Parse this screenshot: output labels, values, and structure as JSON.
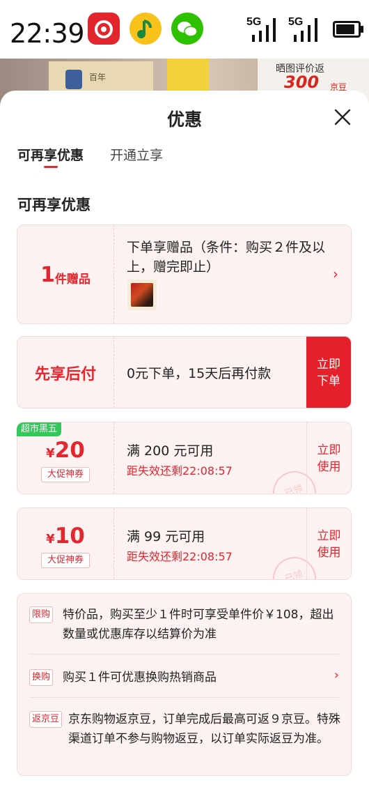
{
  "status_bar": {
    "time": "22:39",
    "network_1": "5G",
    "network_2": "5G"
  },
  "background": {
    "sign_top": "晒图评价返",
    "sign_amount": "300",
    "sign_unit": "京豆",
    "box_text": "百年"
  },
  "sheet": {
    "title": "优惠",
    "tabs": [
      {
        "label": "可再享优惠",
        "active": true
      },
      {
        "label": "开通立享",
        "active": false
      }
    ],
    "section_title": "可再享优惠",
    "gift_card": {
      "count": "1",
      "unit": "件赠品",
      "description": "下单享赠品（条件：购买２件及以上，赠完即止）"
    },
    "pay_later_card": {
      "label": "先享后付",
      "description": "0元下单，15天后再付款",
      "button": "立即下单"
    },
    "coupons": [
      {
        "ribbon": "超市黑五",
        "currency": "¥",
        "amount": "20",
        "tag": "大促神券",
        "condition": "满 200 元可用",
        "countdown": "距失效还剩22:08:57",
        "button": "立即使用",
        "stamp": "已领"
      },
      {
        "ribbon": "",
        "currency": "¥",
        "amount": "10",
        "tag": "大促神券",
        "condition": "满 99 元可用",
        "countdown": "距失效还剩22:08:57",
        "button": "立即使用",
        "stamp": "已领"
      }
    ],
    "rules": [
      {
        "label": "限购",
        "text": "特价品，购买至少１件时可享受单件价￥108，超出数量或优惠库存以结算价为准"
      },
      {
        "label": "换购",
        "text": "购买１件可优惠换购热销商品"
      },
      {
        "label": "返京豆",
        "text": "京东购物返京豆，订单完成后最高可返９京豆。特殊渠道订单不参与购物返豆，以订单实际返豆为准。"
      }
    ]
  },
  "colors": {
    "accent": "#e4262e",
    "button_red": "#e5202a",
    "card_bg": "#fdf2f2",
    "ribbon_green": "#34c759"
  }
}
